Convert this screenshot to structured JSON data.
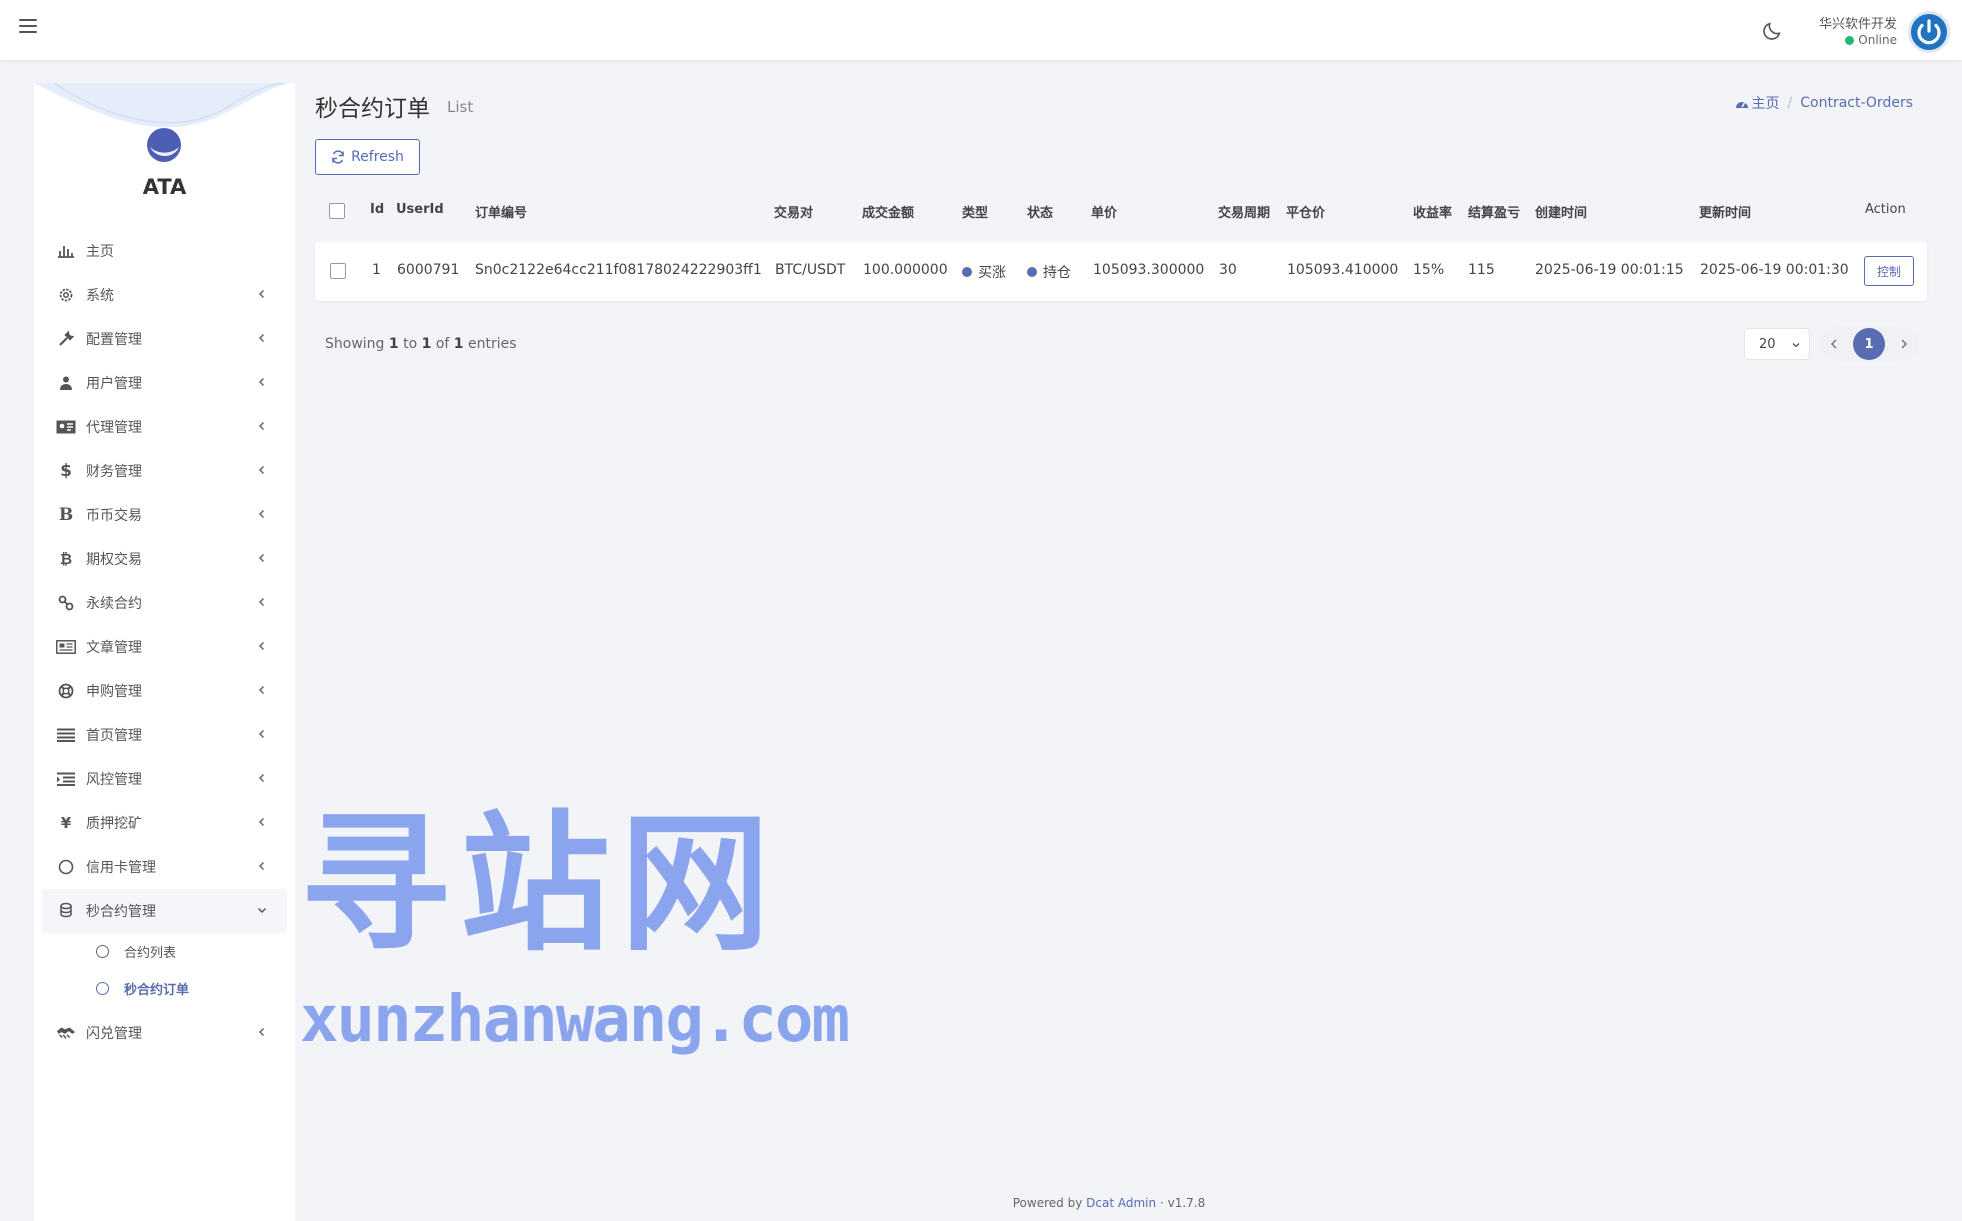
{
  "navbar": {
    "user_name": "华兴软件开发",
    "user_status": "Online",
    "icons": [
      "menu-icon",
      "moon-icon",
      "power-icon"
    ]
  },
  "sidebar": {
    "brand": "ATA",
    "menu": [
      {
        "label": "主页",
        "icon": "bar-chart-icon"
      },
      {
        "label": "系统",
        "icon": "gear-icon"
      },
      {
        "label": "配置管理",
        "icon": "wrench-icon"
      },
      {
        "label": "用户管理",
        "icon": "users-icon"
      },
      {
        "label": "代理管理",
        "icon": "id-card-icon"
      },
      {
        "label": "财务管理",
        "icon": "dollar-icon"
      },
      {
        "label": "币币交易",
        "icon": "letter-b-icon"
      },
      {
        "label": "期权交易",
        "icon": "bitcoin-icon"
      },
      {
        "label": "永续合约",
        "icon": "link-icon"
      },
      {
        "label": "文章管理",
        "icon": "newspaper-icon"
      },
      {
        "label": "申购管理",
        "icon": "lifebuoy-icon"
      },
      {
        "label": "首页管理",
        "icon": "list-icon"
      },
      {
        "label": "风控管理",
        "icon": "indent-icon"
      },
      {
        "label": "质押挖矿",
        "icon": "yen-icon"
      },
      {
        "label": "信用卡管理",
        "icon": "circle-icon"
      },
      {
        "label": "秒合约管理",
        "icon": "coins-icon"
      }
    ],
    "submenu": [
      {
        "label": "合约列表"
      },
      {
        "label": "秒合约订单"
      }
    ],
    "last_item": {
      "label": "闪兑管理",
      "icon": "exchange-icon"
    }
  },
  "header": {
    "title": "秒合约订单",
    "subtitle": "List",
    "breadcrumb_home": "主页",
    "breadcrumb_current": "Contract-Orders"
  },
  "toolbar": {
    "refresh_label": "Refresh"
  },
  "table": {
    "columns": [
      "Id",
      "UserId",
      "订单编号",
      "交易对",
      "成交金额",
      "类型",
      "状态",
      "单价",
      "交易周期",
      "平仓价",
      "收益率",
      "结算盈亏",
      "创建时间",
      "更新时间",
      "Action"
    ],
    "rows": [
      {
        "id": "1",
        "user_id": "6000791",
        "order_no": "Sn0c2122e64cc211f08178024222903ff1",
        "pair": "BTC/USDT",
        "amount": "100.000000",
        "type": "买涨",
        "status": "持仓",
        "price": "105093.300000",
        "period": "30",
        "close_price": "105093.410000",
        "rate": "15%",
        "pnl": "115",
        "created_at": "2025-06-19 00:01:15",
        "updated_at": "2025-06-19 00:01:30",
        "action_label": "控制"
      }
    ]
  },
  "pagination": {
    "showing_prefix": "Showing",
    "from": "1",
    "to_word": "to",
    "to": "1",
    "of_word": "of",
    "total": "1",
    "entries_word": "entries",
    "per_page": "20",
    "current_page": "1"
  },
  "watermark": {
    "cn": "寻站网",
    "en": "xunzhanwang.com"
  },
  "footer": {
    "powered_by": "Powered by",
    "link": "Dcat Admin",
    "sep": "·",
    "version": "v1.7.8"
  },
  "colors": {
    "accent": "#586cb1",
    "online": "#21b978",
    "watermark": "#8aa5ee"
  }
}
